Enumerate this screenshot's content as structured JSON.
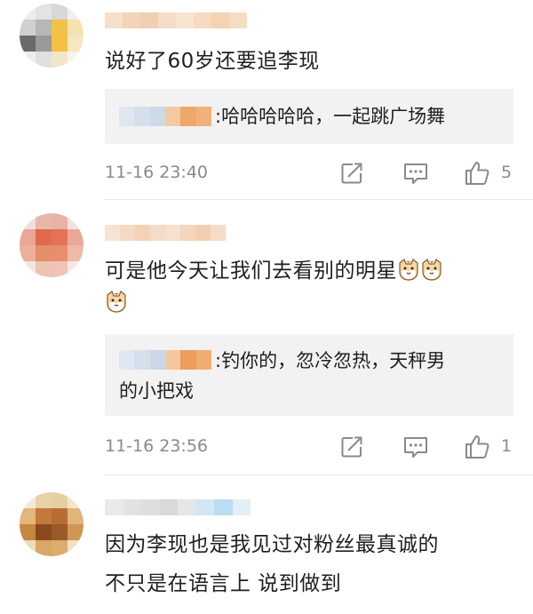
{
  "comments": [
    {
      "text": "说好了60岁还要追李现",
      "reply": {
        "text": "哈哈哈哈哈，一起跳广场舞",
        "prefix": ":"
      },
      "timestamp": "11-16 23:40",
      "likes": "5",
      "avatar_colors": [
        "#ececec",
        "#e3e3e3",
        "#d8d8d8",
        "#efefef",
        "#cfcfcf",
        "#b7b7b7",
        "#f0c24a",
        "#f5e2b0",
        "#6a6a6a",
        "#9a9a9a",
        "#f3c041",
        "#f7e7c0",
        "#ededed",
        "#e0e0e0",
        "#f1e6cc",
        "#f8f4ea"
      ],
      "name_colors": [
        "#f6e0cc",
        "#f3d4b7",
        "#f1cfb1",
        "#f6dcc6",
        "#f8e4d2",
        "#f7dac0",
        "#f4d2b2",
        "#f6dcc4"
      ],
      "reply_name_colors": [
        "#dfe7f1",
        "#d4e0ee",
        "#cfd9e6",
        "#f3c9a3",
        "#f1a66a",
        "#f0b27d"
      ]
    },
    {
      "text_lines": [
        "可是他今天让我们去看别的明星",
        ""
      ],
      "reply": {
        "text_lines": [
          "钓你的，忽冷忽热，天秤男",
          "的小把戏"
        ],
        "prefix": ":"
      },
      "timestamp": "11-16 23:56",
      "likes": "1",
      "avatar_colors": [
        "#f1e0db",
        "#e7b8a9",
        "#e9b2a6",
        "#f1e2dd",
        "#e9a795",
        "#e06a4b",
        "#e4725a",
        "#eaa897",
        "#ecb09a",
        "#e58e6a",
        "#e88d6d",
        "#eeb9a8",
        "#f3e6e1",
        "#edc3b3",
        "#efc4b6",
        "#f4e8e4"
      ],
      "name_colors": [
        "#f7e3d3",
        "#f5d9c3",
        "#f3d2b8",
        "#f6dcc8",
        "#f7e0cc",
        "#f5d6bd",
        "#f3cfb2",
        "#f6dcc6"
      ],
      "reply_name_colors": [
        "#dfe7f1",
        "#d5e0ec",
        "#cbd7e6",
        "#f3c7a0",
        "#ee9d5c",
        "#f0ad72"
      ]
    },
    {
      "text_lines": [
        "因为李现也是我见过对粉丝最真诚的",
        "不只是在语言上 说到做到"
      ],
      "avatar_colors": [
        "#f3ead6",
        "#e7d2a7",
        "#e6cf9f",
        "#f2e6cf",
        "#e2b87a",
        "#c27a3a",
        "#b86d34",
        "#e0b47b",
        "#c48740",
        "#8a4a1e",
        "#9b5a27",
        "#cf9754",
        "#efdcb8",
        "#d9a766",
        "#dcad6e",
        "#f1e1c3"
      ],
      "name_colors": [
        "#e9e9e9",
        "#e2e2e2",
        "#dedede",
        "#d9d9d9",
        "#e6e6e6",
        "#d2e6f6",
        "#bcdcf3",
        "#e4eef6"
      ]
    }
  ],
  "icons": [
    "share-icon",
    "comment-icon",
    "like-icon",
    "cat-emoji-icon"
  ]
}
